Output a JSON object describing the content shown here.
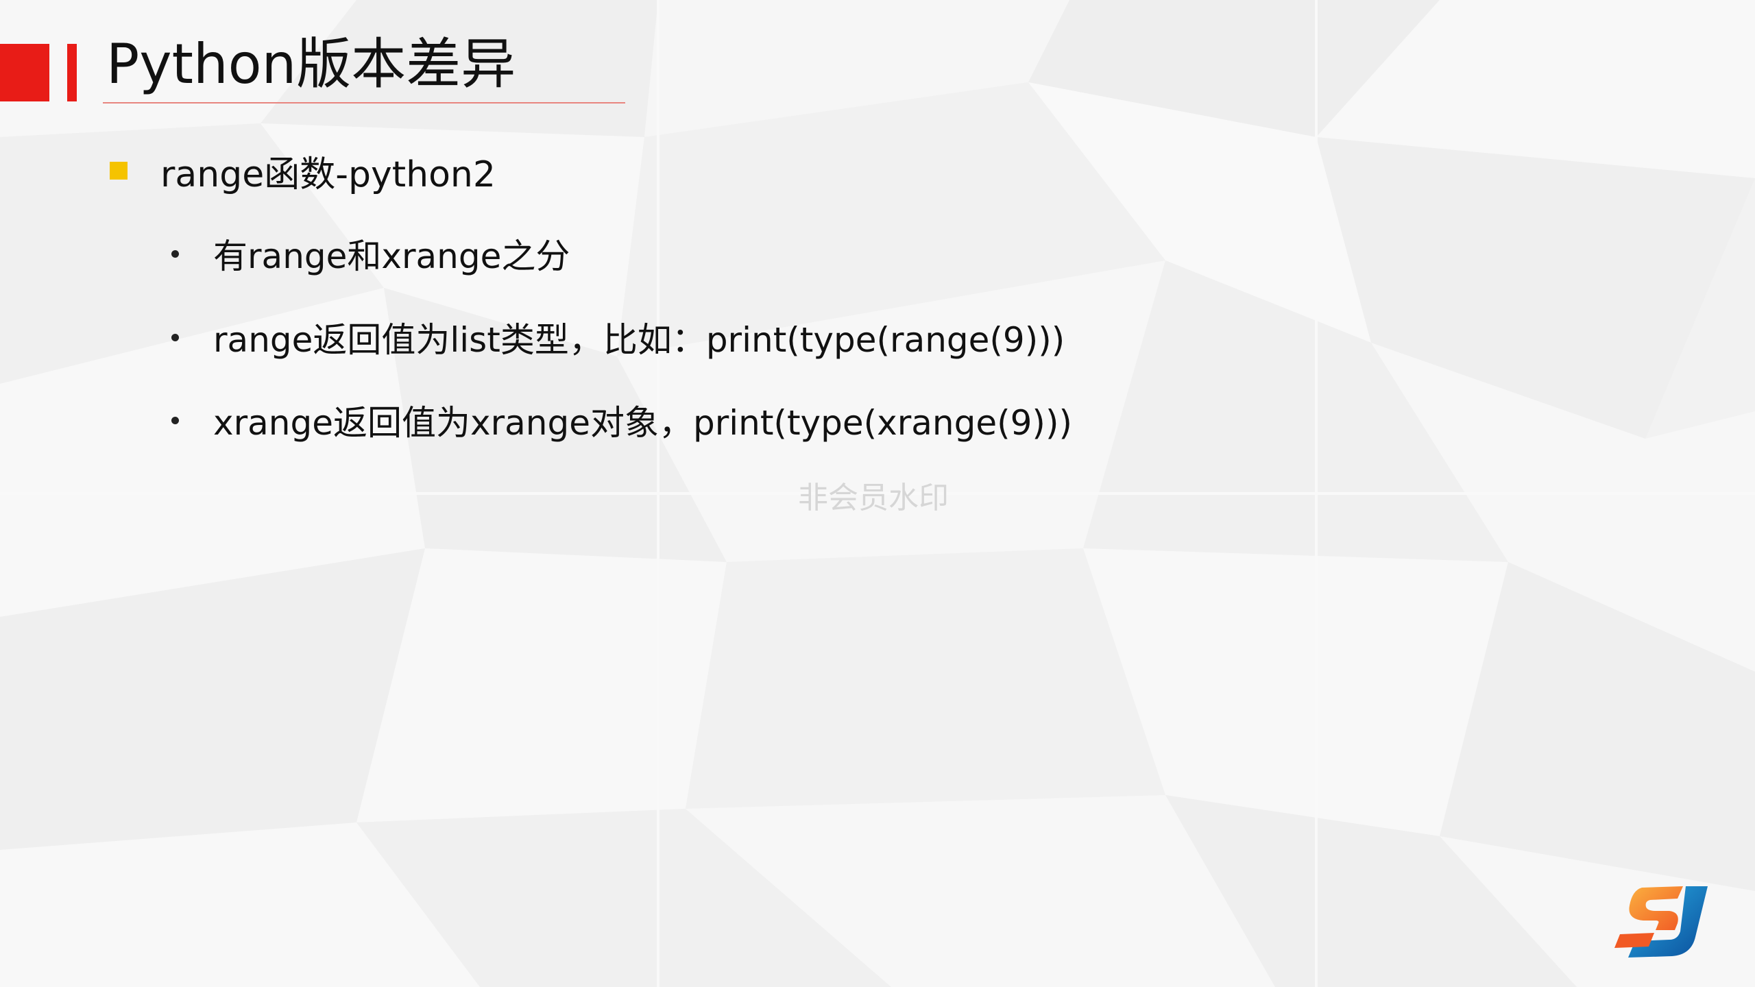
{
  "slide": {
    "title": "Python版本差异",
    "bullet": "range函数-python2",
    "sub_bullets": [
      "有range和xrange之分",
      "range返回值为list类型，比如：print(type(range(9)))",
      "xrange返回值为xrange对象，print(type(xrange(9)))"
    ],
    "watermark": "非会员水印"
  },
  "colors": {
    "accent_red": "#e81c17",
    "bullet_yellow": "#f5c300",
    "logo_orange": "#f7941d",
    "logo_blue": "#1b75bc"
  },
  "icons": {
    "logo": "sj-logo-icon"
  }
}
